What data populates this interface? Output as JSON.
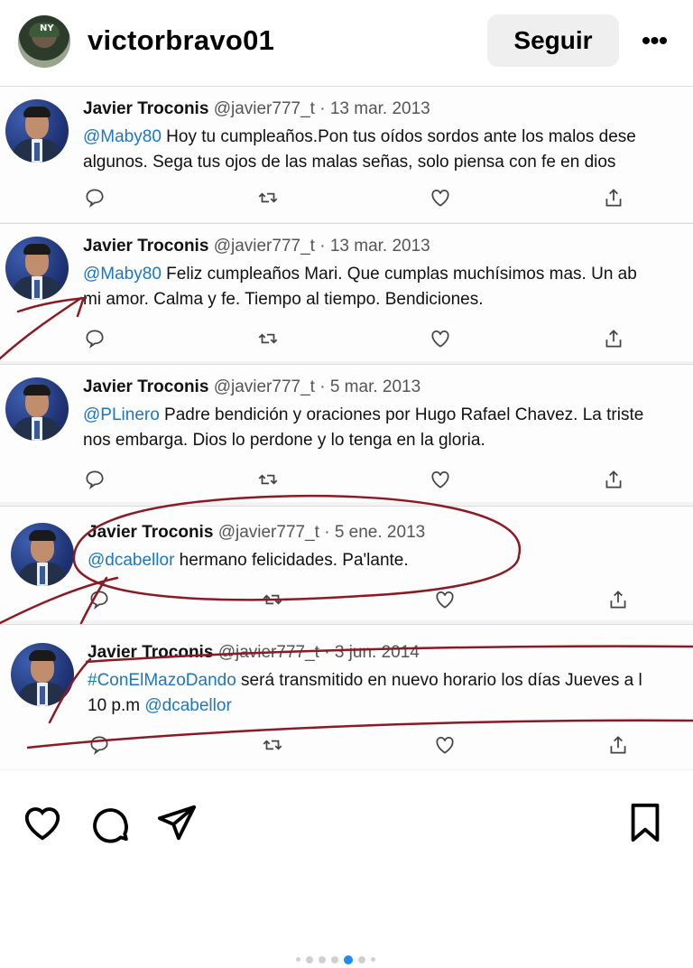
{
  "header": {
    "username": "victorbravo01",
    "follow_label": "Seguir",
    "more_glyph": "•••"
  },
  "tweets": [
    {
      "name": "Javier Troconis",
      "handle": "@javier777_t",
      "date": "· 13 mar. 2013",
      "mention": "@Maby80",
      "line1": " Hoy tu cumpleaños.Pon tus oídos sordos ante los malos dese",
      "line2": "algunos. Sega tus ojos de las malas señas, solo piensa con fe en dios"
    },
    {
      "name": "Javier Troconis",
      "handle": "@javier777_t",
      "date": "· 13 mar. 2013",
      "mention": "@Maby80",
      "line1": " Feliz cumpleaños Mari. Que cumplas muchísimos mas. Un ab",
      "line2": "mi amor. Calma y fe. Tiempo al tiempo. Bendiciones."
    },
    {
      "name": "Javier Troconis",
      "handle": "@javier777_t",
      "date": "· 5 mar. 2013",
      "mention": "@PLinero",
      "line1": " Padre bendición y oraciones por Hugo Rafael Chavez. La triste",
      "line2": "nos embarga. Dios lo perdone y lo tenga en la gloria."
    },
    {
      "name": "Javier Troconis",
      "handle": "@javier777_t",
      "date": "· 5 ene. 2013",
      "mention": "@dcabellor",
      "line1": " hermano felicidades. Pa'lante.",
      "line2": ""
    },
    {
      "name": "Javier Troconis",
      "handle": "@javier777_t",
      "date": "· 3 jun. 2014",
      "mention": "#ConElMazoDando",
      "line1": " será transmitido en nuevo horario los días Jueves a l",
      "line2_pre": "10 p.m ",
      "line2_mention": "@dcabellor"
    }
  ],
  "carousel": {
    "total": 7,
    "active_index": 4
  },
  "colors": {
    "mention": "#1d76c0",
    "scribble": "#8b1a24",
    "active_dot": "#1d8cf0"
  },
  "icons": [
    "like-icon",
    "comment-icon",
    "share-icon",
    "save-icon",
    "reply-icon",
    "retweet-icon",
    "heart-icon",
    "upload-icon"
  ]
}
